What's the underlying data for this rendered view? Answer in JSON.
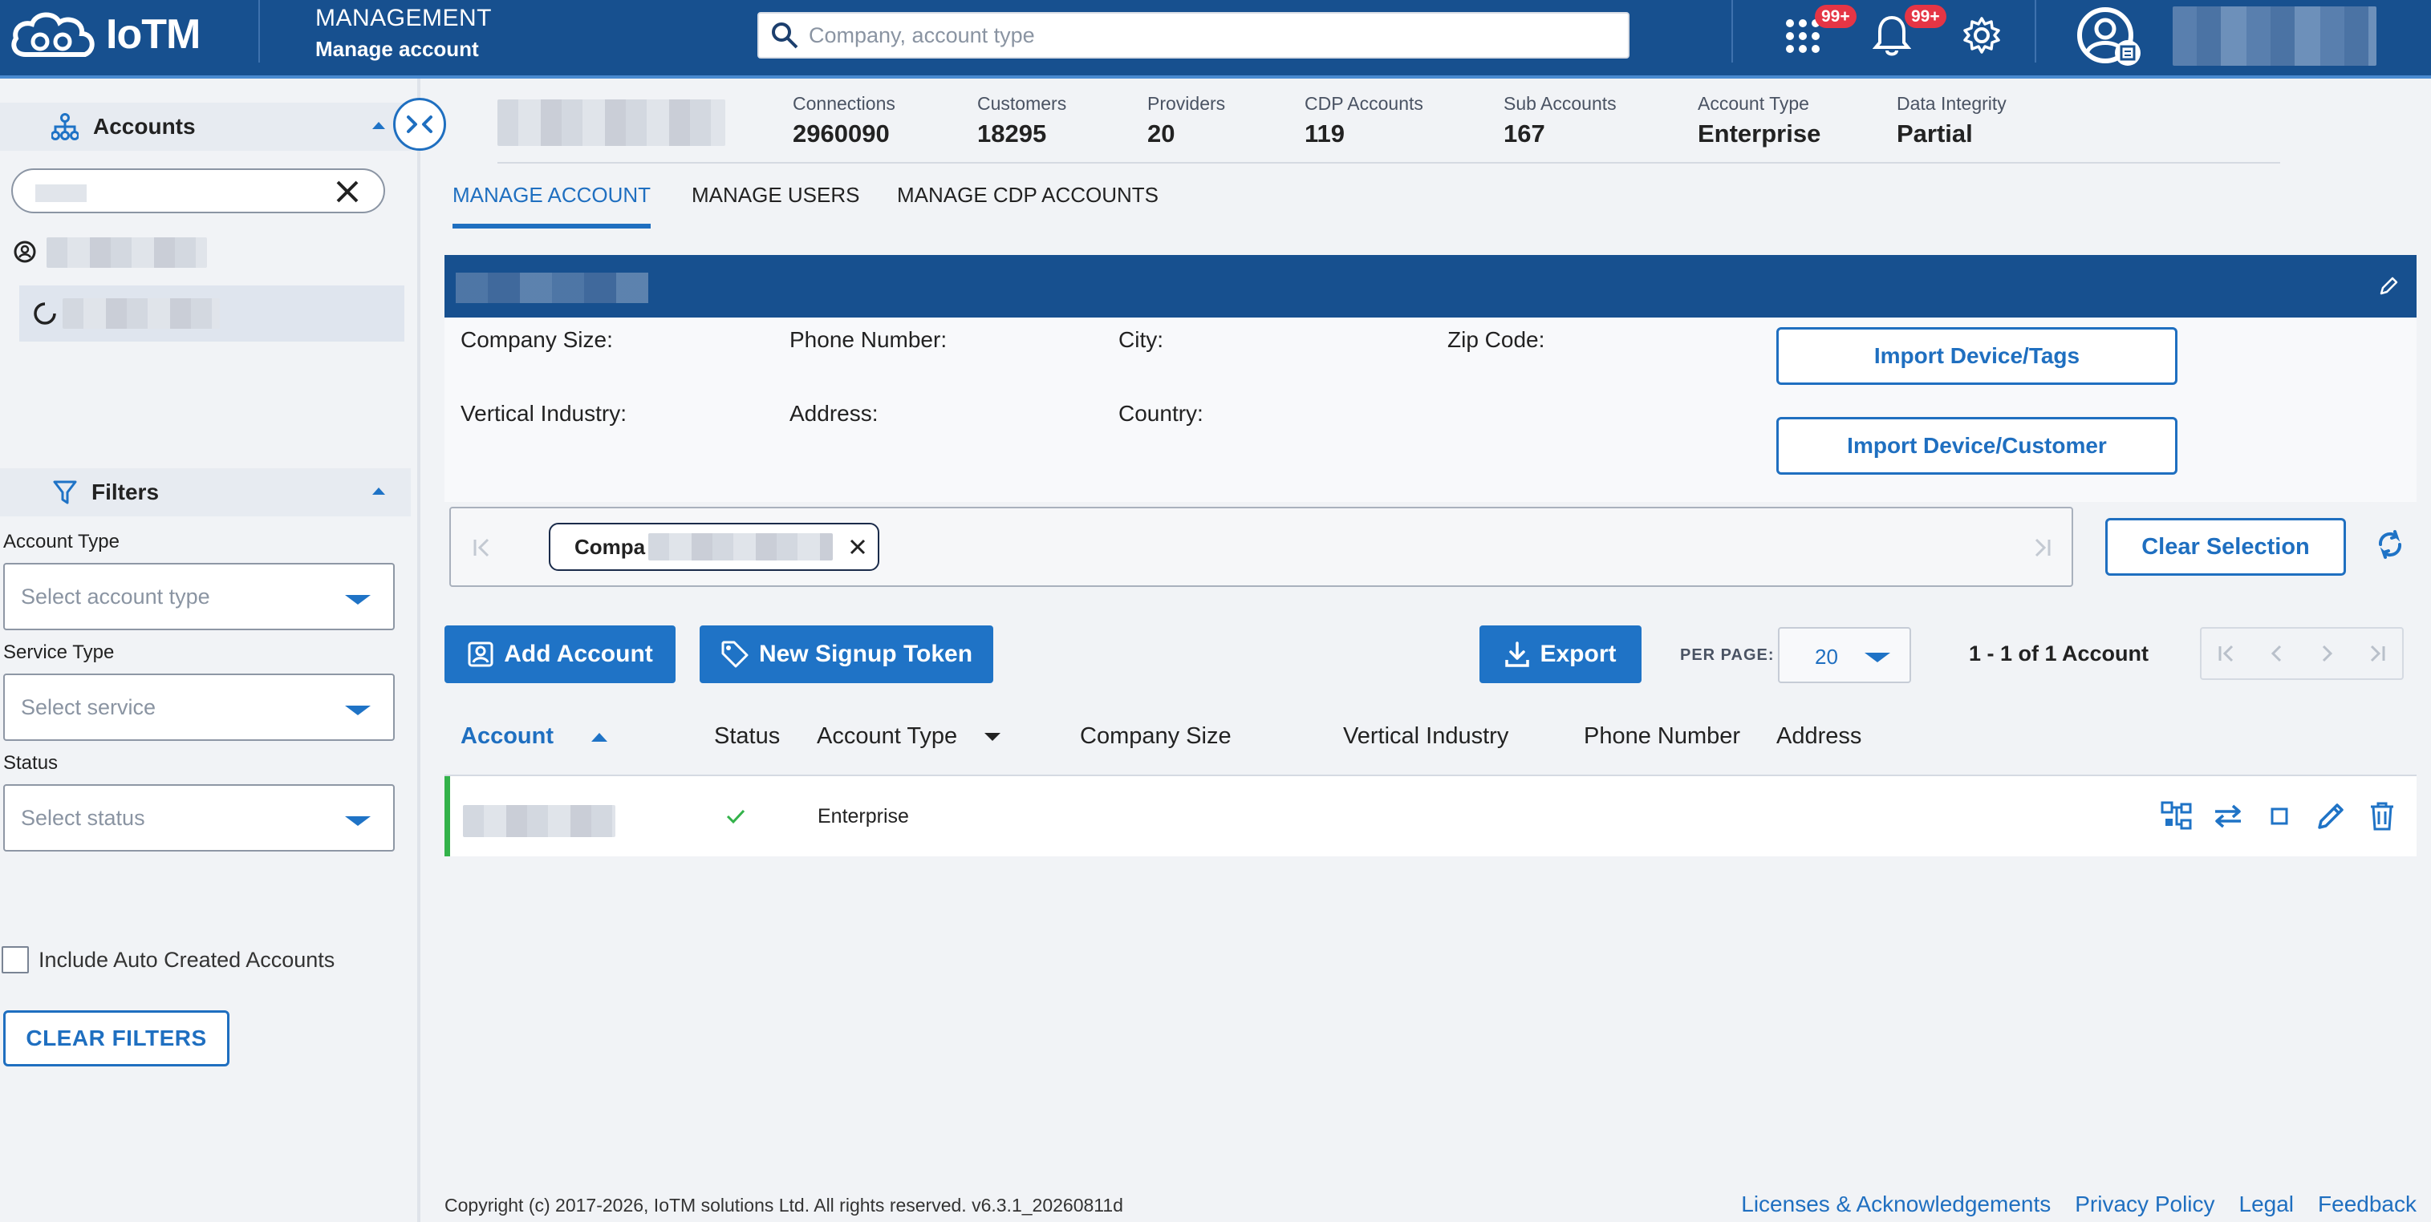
{
  "header": {
    "logo_text": "IoTM",
    "section_title": "MANAGEMENT",
    "section_subtitle": "Manage account",
    "search_placeholder": "Company, account type",
    "apps_badge": "99+",
    "notifications_badge": "99+"
  },
  "sidebar": {
    "accounts_heading": "Accounts",
    "filters_heading": "Filters",
    "account_type_label": "Account Type",
    "account_type_placeholder": "Select account type",
    "service_type_label": "Service Type",
    "service_type_placeholder": "Select service",
    "status_label": "Status",
    "status_placeholder": "Select status",
    "auto_created_label": "Include Auto Created Accounts",
    "clear_filters_label": "CLEAR FILTERS"
  },
  "stats": [
    {
      "label": "Connections",
      "value": "2960090"
    },
    {
      "label": "Customers",
      "value": "18295"
    },
    {
      "label": "Providers",
      "value": "20"
    },
    {
      "label": "CDP Accounts",
      "value": "119"
    },
    {
      "label": "Sub Accounts",
      "value": "167"
    },
    {
      "label": "Account Type",
      "value": "Enterprise"
    },
    {
      "label": "Data Integrity",
      "value": "Partial"
    }
  ],
  "tabs": [
    {
      "label": "MANAGE ACCOUNT",
      "active": true
    },
    {
      "label": "MANAGE USERS",
      "active": false
    },
    {
      "label": "MANAGE CDP ACCOUNTS",
      "active": false
    }
  ],
  "details": {
    "company_size_label": "Company Size:",
    "phone_label": "Phone Number:",
    "city_label": "City:",
    "zip_label": "Zip Code:",
    "industry_label": "Vertical Industry:",
    "address_label": "Address:",
    "country_label": "Country:",
    "import_tags_label": "Import Device/Tags",
    "import_customer_label": "Import Device/Customer"
  },
  "selection": {
    "chip_text": "Compa",
    "clear_selection_label": "Clear Selection"
  },
  "toolbar": {
    "add_account_label": "Add Account",
    "signup_token_label": "New Signup Token",
    "export_label": "Export",
    "per_page_label": "PER PAGE:",
    "per_page_value": "20",
    "range_text": "1 - 1 of 1 Account"
  },
  "table": {
    "columns": [
      "Account",
      "Status",
      "Account Type",
      "Company Size",
      "Vertical Industry",
      "Phone Number",
      "Address"
    ],
    "rows": [
      {
        "account_type": "Enterprise",
        "status": "active"
      }
    ]
  },
  "footer": {
    "copyright": "Copyright (c) 2017-2026, IoTM solutions Ltd. All rights reserved. v6.3.1_20260811d",
    "links": [
      "Licenses & Acknowledgements",
      "Privacy Policy",
      "Legal",
      "Feedback"
    ]
  },
  "colors": {
    "header_bg": "#17508f",
    "accent": "#1f73c6",
    "badge": "#e53545",
    "row_status": "#33b24a"
  }
}
